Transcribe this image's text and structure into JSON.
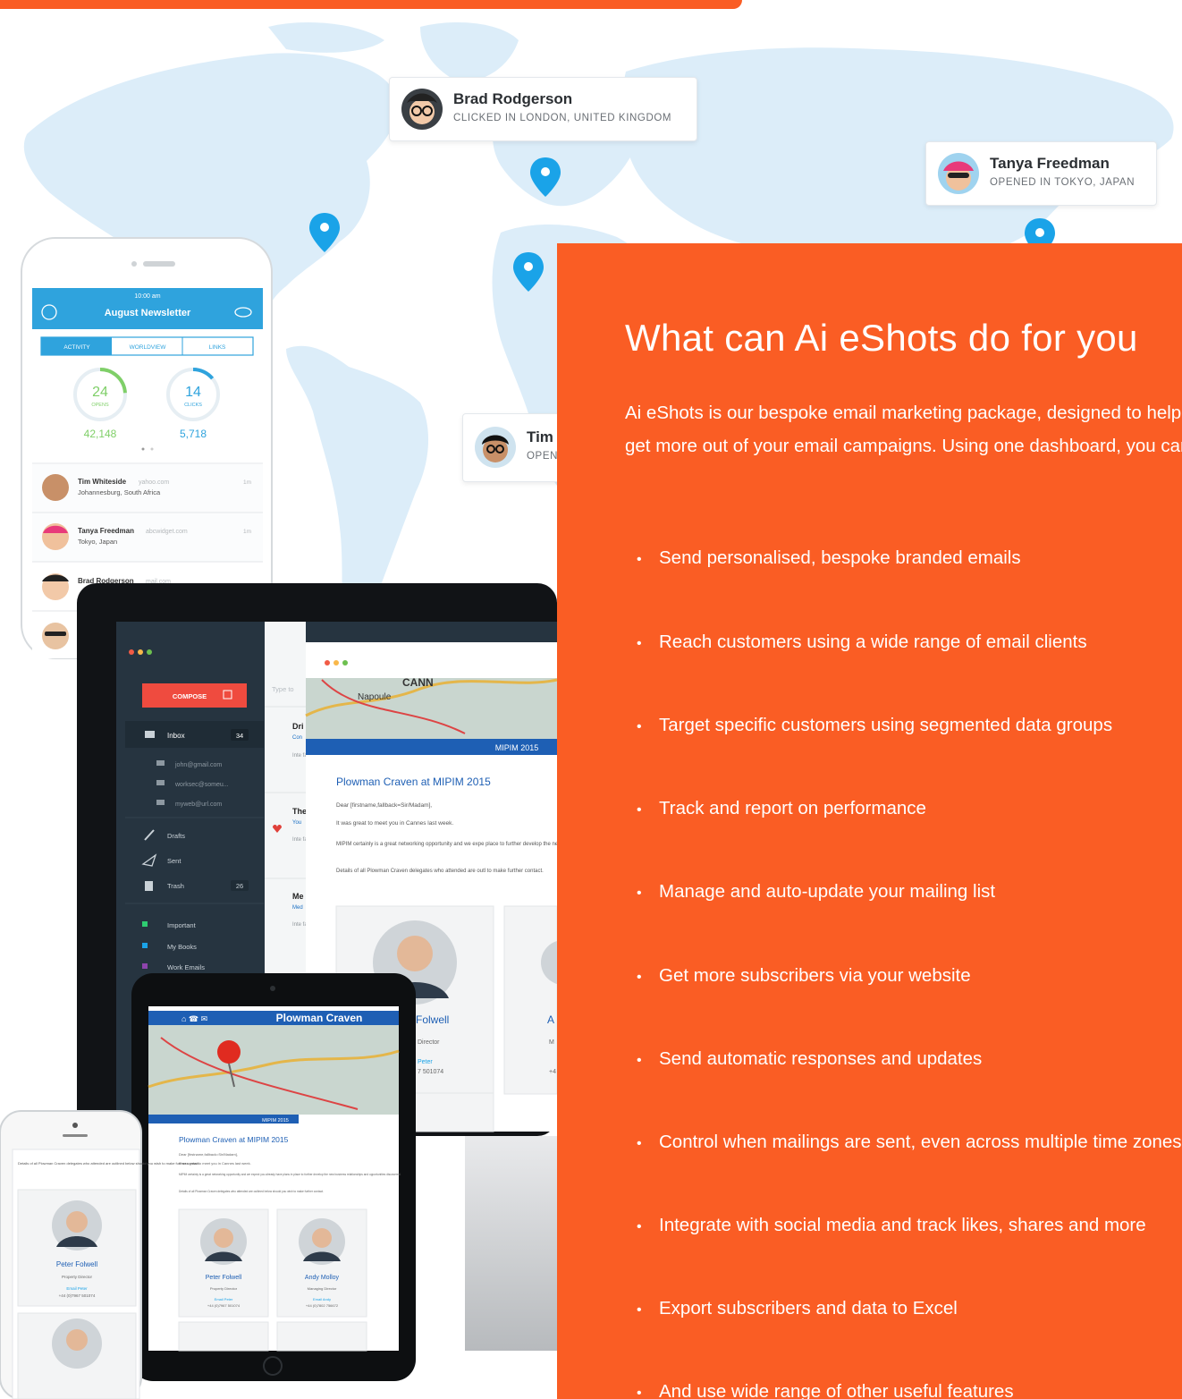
{
  "map_cards": {
    "brad": {
      "name": "Brad Rodgerson",
      "status": "CLICKED IN LONDON, UNITED KINGDOM"
    },
    "tanya": {
      "name": "Tanya Freedman",
      "status": "OPENED IN TOKYO, JAPAN"
    },
    "tim": {
      "name": "Tim",
      "status": "OPEN"
    }
  },
  "phone_app": {
    "time": "10:00 am",
    "title": "August Newsletter",
    "tabs": [
      "ACTIVITY",
      "WORLDVIEW",
      "LINKS"
    ],
    "opens": {
      "pct": "24",
      "label": "OPENS",
      "count": "42,148",
      "fraction": 0.24
    },
    "clicks": {
      "pct": "14",
      "label": "CLICKS",
      "count": "5,718",
      "fraction": 0.14
    },
    "contacts": [
      {
        "name": "Tim Whiteside",
        "email": "yahoo.com",
        "location": "Johannesburg, South Africa",
        "time": "1m"
      },
      {
        "name": "Tanya Freedman",
        "email": "abcwidget.com",
        "location": "Tokyo, Japan",
        "time": "1m"
      },
      {
        "name": "Brad Rodgerson",
        "email": "mail.com",
        "location": "",
        "time": ""
      }
    ]
  },
  "desktop_app": {
    "compose": "COMPOSE",
    "inbox": {
      "label": "Inbox",
      "count": "34"
    },
    "accounts": [
      "john@gmail.com",
      "worksec@someu...",
      "myweb@url.com"
    ],
    "folders": [
      {
        "label": "Drafts",
        "count": ""
      },
      {
        "label": "Sent",
        "count": ""
      },
      {
        "label": "Trash",
        "count": "26"
      }
    ],
    "labels": [
      {
        "label": "Important",
        "color": "#2ecc71"
      },
      {
        "label": "My Books",
        "color": "#1aa3e8"
      },
      {
        "label": "Work Emails",
        "color": "#8e44ad"
      }
    ],
    "search_placeholder": "Type to",
    "messages": [
      {
        "title": "Dri",
        "sub": "Con",
        "body": "Inte facil scin"
      },
      {
        "title": "The",
        "sub": "You",
        "body": "Inte facil ing c"
      },
      {
        "title": "Me",
        "sub": "Med",
        "body": "Inte facil ing c"
      }
    ],
    "email": {
      "map_text": "Napoule",
      "map_text2": "CANN",
      "banner": "MIPIM 2015",
      "heading": "Plowman Craven at MIPIM 2015",
      "greeting": "Dear [firstname,fallback=Sir/Madam],",
      "line1": "It was great to meet you in Cannes last week.",
      "line2": "MIPIM certainly is a great networking opportunity and we expe place to further develop the new business relationships and op",
      "line3": "Details of all Plowman Craven delegates who attended are outl to make further contact.",
      "person1": {
        "name": "Folwell",
        "role": "Director",
        "email": "Peter",
        "phone": "7 501074"
      },
      "person2": {
        "name": "A",
        "role": "M",
        "phone": "+4"
      }
    }
  },
  "tablet_app": {
    "brand": "Plowman Craven",
    "banner": "MIPIM 2015",
    "heading": "Plowman Craven at MIPIM 2015",
    "greeting": "Dear [firstname,fallback=Sir/Madam],",
    "line1": "It was great to meet you in Cannes last week.",
    "line2": "MIPIM certainly is a great networking opportunity and we expect you already have plans in place to further develop the new business relationships and opportunities discovered.",
    "line3": "Details of all Plowman Craven delegates who attended are outlined below should you wish to make further contact.",
    "people": [
      {
        "name": "Peter Folwell",
        "role": "Property Director",
        "email": "Email Peter",
        "phone": "+44 (0)7967 501074"
      },
      {
        "name": "Andy Molloy",
        "role": "Managing Director",
        "email": "Email Andy",
        "phone": "+44 (0)7802 756672"
      }
    ]
  },
  "small_phone": {
    "text": "Details of all Plowman Craven delegates who attended are outlined below should you wish to make further contact.",
    "person": {
      "name": "Peter Folwell",
      "role": "Property Director",
      "email": "Email Peter",
      "phone": "+44 (0)7967 501074"
    }
  },
  "panel": {
    "heading": "What can Ai eShots do for you",
    "intro": "Ai eShots is our bespoke email marketing package, designed to help you get more out of your email campaigns. Using one dashboard, you can:",
    "features": [
      "Send personalised, bespoke branded emails",
      "Reach customers using a wide range of email clients",
      "Target specific customers using segmented data groups",
      "Track and report on performance",
      "Manage and auto-update your mailing list",
      "Get more subscribers via your website",
      "Send automatic responses and updates",
      "Control when mailings are sent, even across multiple time zones",
      "Integrate with social media and track likes, shares and more",
      "Export subscribers and data to Excel",
      "And use wide range of other useful features"
    ]
  },
  "colors": {
    "accent": "#fa5d24",
    "map": "#dcedf9",
    "pin": "#1aa3e8",
    "sidebar": "#263440",
    "compose": "#ef4b3f",
    "tablet_header": "#1e5fb4"
  }
}
